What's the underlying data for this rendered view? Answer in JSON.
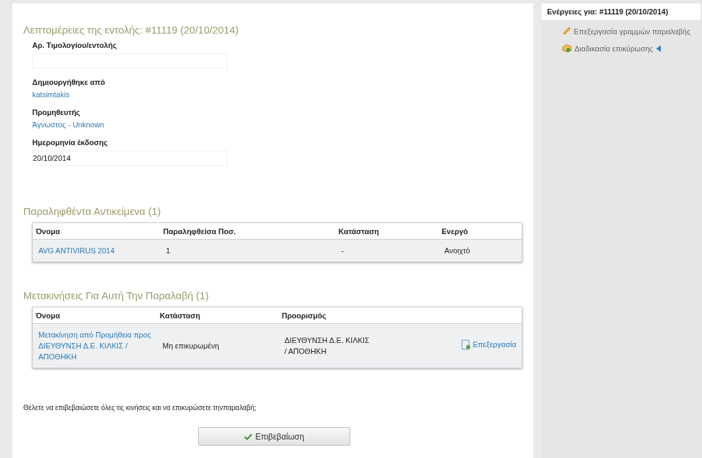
{
  "details": {
    "title": "Λεπτομέρειες της εντολής: #11119 (20/10/2014)",
    "fields": [
      {
        "label": "Αρ. Τιμολογίου/εντολής",
        "kind": "input"
      },
      {
        "label": "Δημιουργήθηκε από",
        "kind": "link",
        "value": "katsimtakis"
      },
      {
        "label": "Προμηθευτής",
        "kind": "link",
        "value": "Άγνωστος - Unknown"
      },
      {
        "label": "Ημερομηνία έκδοσης",
        "kind": "input",
        "value": "20/10/2014"
      }
    ]
  },
  "received_items": {
    "title": "Παραληφθέντα Αντικείμενα (1)",
    "columns": [
      "Όνομα",
      "Παραληφθείσα Ποσ.",
      "Κατάσταση",
      "Ενεργό"
    ],
    "rows": [
      [
        "AVG ANTIVIRUS 2014",
        "1",
        "-",
        "Ανοιχτό"
      ]
    ]
  },
  "movements": {
    "title": "Μετακινήσεις Για Αυτή Την Παραλαβή (1)",
    "columns": [
      "Όνομα",
      "Κατάσταση",
      "Προορισμός"
    ],
    "rows": [
      {
        "name": "Μετακίνηση από Προμήθεια προς ΔΙΕΥΘΥΝΣΗ Δ.Ε. ΚΙΛΚΙΣ / ΑΠΟΘΗΚΗ",
        "status": "Μη επικυρωμένη",
        "destination": "ΔΙΕΥΘΥΝΣΗ Δ.Ε. ΚΙΛΚΙΣ / ΑΠΟΘΗΚΗ",
        "action": "Επεξεργασία"
      }
    ]
  },
  "confirm_question": "Θέλετε να επιβεβαιώσετε όλες τις κινήσεις και να επικυρώσετε τηνπαραλαβή;",
  "confirm_button": "Επιβεβαίωση",
  "sidebar": {
    "title": "Ενέργειες για: #11119 (20/10/2014)",
    "items": [
      {
        "label": "Επεξεργασία γραμμών παραλαβής",
        "kind": "edit",
        "current": false
      },
      {
        "label": "Διαδικασία επικύρωσης",
        "kind": "process",
        "current": true
      }
    ]
  }
}
